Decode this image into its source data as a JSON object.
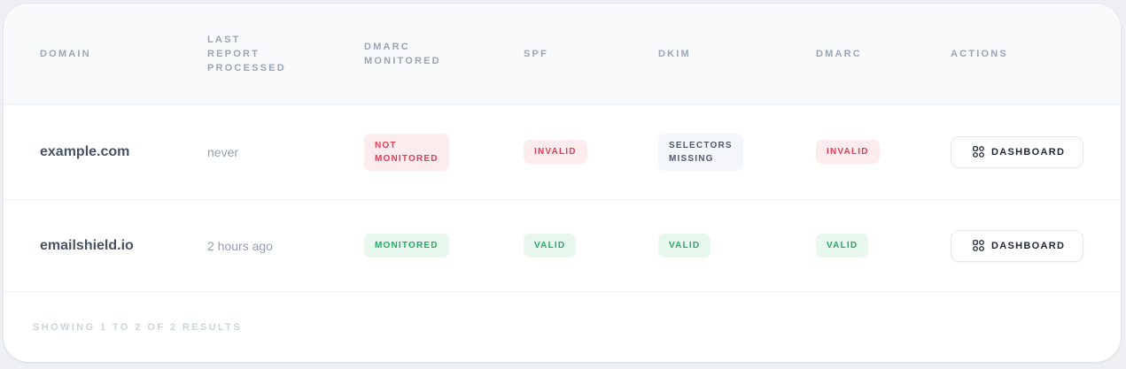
{
  "table": {
    "headers": {
      "domain": "Domain",
      "last_report_l1": "Last",
      "last_report_l2": "Report",
      "last_report_l3": "Processed",
      "dmarc_monitored_l1": "DMARC",
      "dmarc_monitored_l2": "Monitored",
      "spf": "SPF",
      "dkim": "DKIM",
      "dmarc": "DMARC",
      "actions": "Actions"
    },
    "rows": [
      {
        "domain": "example.com",
        "last_report": "never",
        "monitored_l1": "Not",
        "monitored_l2": "Monitored",
        "spf": "Invalid",
        "dkim_l1": "Selectors",
        "dkim_l2": "Missing",
        "dmarc": "Invalid",
        "action": "Dashboard"
      },
      {
        "domain": "emailshield.io",
        "last_report": "2 hours ago",
        "monitored": "Monitored",
        "spf": "Valid",
        "dkim": "Valid",
        "dmarc": "Valid",
        "action": "Dashboard"
      }
    ]
  },
  "footer": {
    "results": "Showing 1 to 2 of 2 results"
  },
  "icons": {
    "action_icon": "dashboard-grid-icon"
  },
  "colors": {
    "invalid": "#e23d55",
    "valid": "#1fae62",
    "neutral": "#4d5869"
  }
}
